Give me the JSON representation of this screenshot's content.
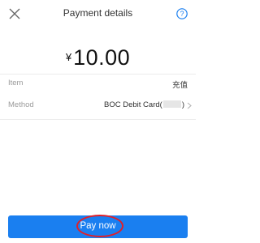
{
  "header": {
    "title": "Payment details",
    "close_icon": "close-icon",
    "help_icon": "help-icon"
  },
  "amount": {
    "currency": "¥",
    "value": "10.00"
  },
  "details": {
    "item_label": "Item",
    "item_value": "充值",
    "method_label": "Method",
    "method_prefix": "BOC Debit Card(",
    "method_suffix": ")"
  },
  "actions": {
    "pay_label": "Pay now"
  },
  "colors": {
    "accent": "#1a7ff0",
    "highlight": "#e0202a"
  }
}
